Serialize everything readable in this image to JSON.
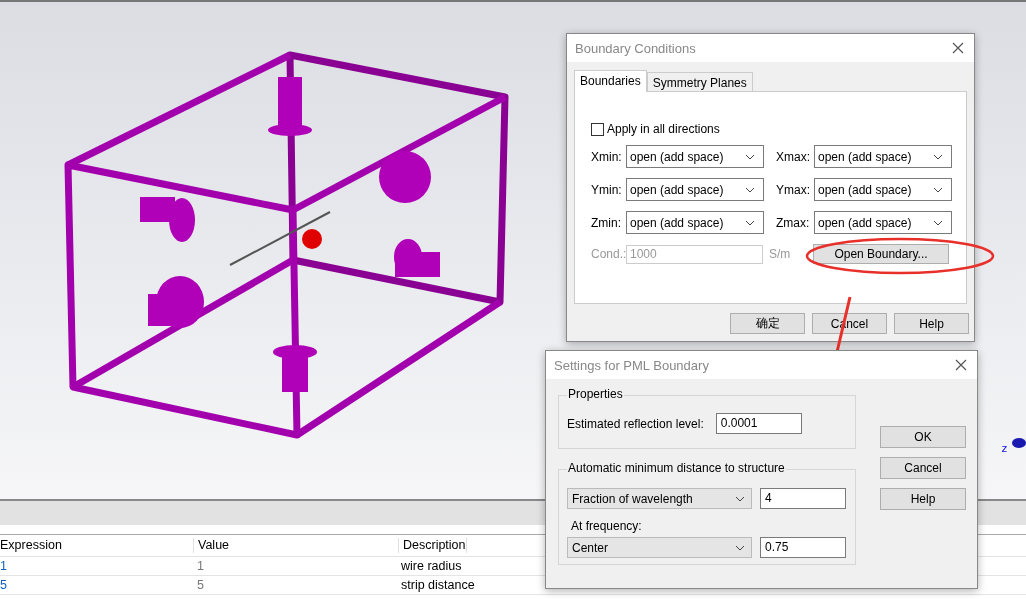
{
  "viewport": {
    "axis_label": "z"
  },
  "table": {
    "columns": [
      "Expression",
      "Value",
      "Description"
    ],
    "rows": [
      {
        "cells": [
          "1",
          "1",
          "wire radius"
        ]
      },
      {
        "cells": [
          "5",
          "5",
          "strip distance"
        ]
      }
    ]
  },
  "boundary_dialog": {
    "title": "Boundary Conditions",
    "tabs": [
      {
        "label": "Boundaries",
        "selected": true
      },
      {
        "label": "Symmetry Planes",
        "selected": false
      }
    ],
    "apply_all": {
      "label": "Apply in all directions",
      "checked": false
    },
    "fields": [
      {
        "label": "Xmin:",
        "value": "open (add space)"
      },
      {
        "label": "Xmax:",
        "value": "open (add space)"
      },
      {
        "label": "Ymin:",
        "value": "open (add space)"
      },
      {
        "label": "Ymax:",
        "value": "open (add space)"
      },
      {
        "label": "Zmin:",
        "value": "open (add space)"
      },
      {
        "label": "Zmax:",
        "value": "open (add space)"
      }
    ],
    "cond": {
      "label": "Cond.:",
      "value": "1000",
      "unit": "S/m",
      "disabled": true
    },
    "open_boundary_button": "Open Boundary...",
    "buttons": [
      "确定",
      "Cancel",
      "Help"
    ]
  },
  "pml_dialog": {
    "title": "Settings for PML Boundary",
    "properties": {
      "legend": "Properties",
      "label": "Estimated reflection level:",
      "value": "0.0001"
    },
    "distance": {
      "legend": "Automatic minimum distance to structure",
      "mode": "Fraction of wavelength",
      "value": "4",
      "frequency_label": "At frequency:",
      "frequency_mode": "Center",
      "frequency_value": "0.75"
    },
    "buttons": [
      "OK",
      "Cancel",
      "Help"
    ]
  }
}
